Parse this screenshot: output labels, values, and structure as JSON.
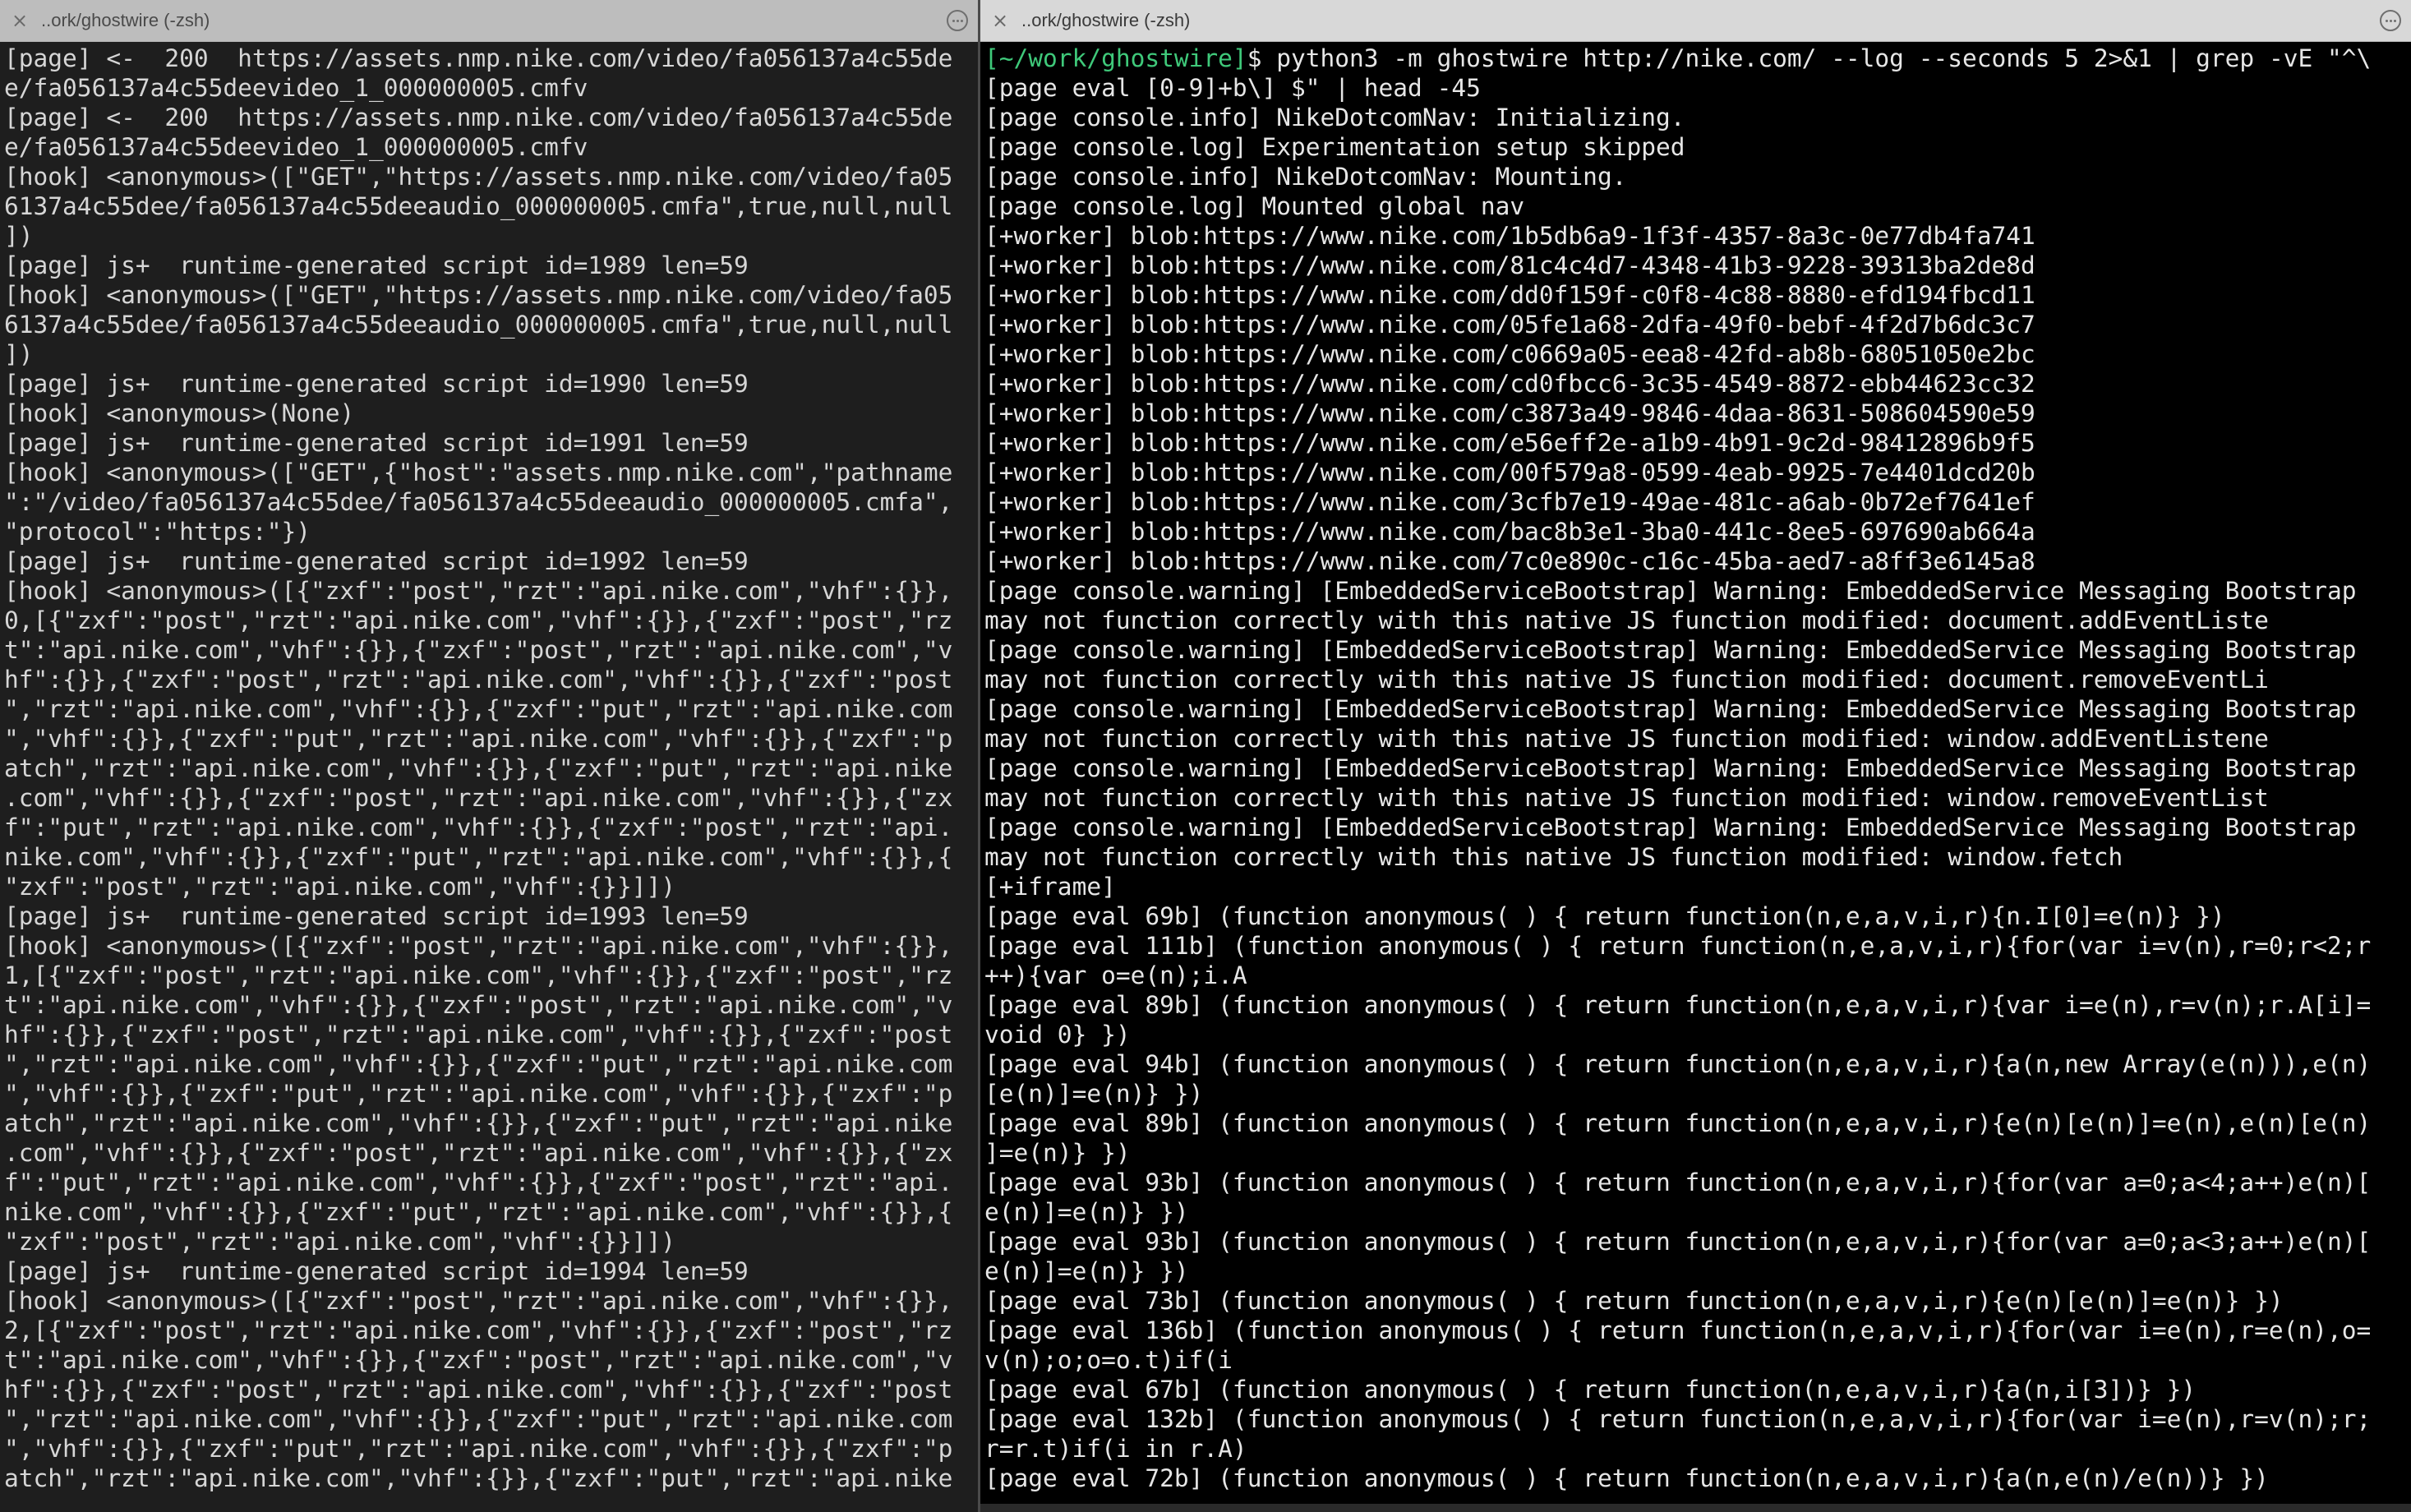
{
  "left_pane": {
    "tab_title": "..ork/ghostwire (-zsh)",
    "lines": [
      "[page] <-  200  https://assets.nmp.nike.com/video/fa056137a4c55de",
      "e/fa056137a4c55deevideo_1_000000005.cmfv",
      "[page] <-  200  https://assets.nmp.nike.com/video/fa056137a4c55de",
      "e/fa056137a4c55deevideo_1_000000005.cmfv",
      "[hook] <anonymous>([\"GET\",\"https://assets.nmp.nike.com/video/fa05",
      "6137a4c55dee/fa056137a4c55deeaudio_000000005.cmfa\",true,null,null",
      "])",
      "[page] js+  runtime-generated script id=1989 len=59",
      "[hook] <anonymous>([\"GET\",\"https://assets.nmp.nike.com/video/fa05",
      "6137a4c55dee/fa056137a4c55deeaudio_000000005.cmfa\",true,null,null",
      "])",
      "[page] js+  runtime-generated script id=1990 len=59",
      "[hook] <anonymous>(None)",
      "[page] js+  runtime-generated script id=1991 len=59",
      "[hook] <anonymous>([\"GET\",{\"host\":\"assets.nmp.nike.com\",\"pathname",
      "\":\"/video/fa056137a4c55dee/fa056137a4c55deeaudio_000000005.cmfa\",",
      "\"protocol\":\"https:\"})",
      "[page] js+  runtime-generated script id=1992 len=59",
      "[hook] <anonymous>([{\"zxf\":\"post\",\"rzt\":\"api.nike.com\",\"vhf\":{}},",
      "0,[{\"zxf\":\"post\",\"rzt\":\"api.nike.com\",\"vhf\":{}},{\"zxf\":\"post\",\"rz",
      "t\":\"api.nike.com\",\"vhf\":{}},{\"zxf\":\"post\",\"rzt\":\"api.nike.com\",\"v",
      "hf\":{}},{\"zxf\":\"post\",\"rzt\":\"api.nike.com\",\"vhf\":{}},{\"zxf\":\"post",
      "\",\"rzt\":\"api.nike.com\",\"vhf\":{}},{\"zxf\":\"put\",\"rzt\":\"api.nike.com",
      "\",\"vhf\":{}},{\"zxf\":\"put\",\"rzt\":\"api.nike.com\",\"vhf\":{}},{\"zxf\":\"p",
      "atch\",\"rzt\":\"api.nike.com\",\"vhf\":{}},{\"zxf\":\"put\",\"rzt\":\"api.nike",
      ".com\",\"vhf\":{}},{\"zxf\":\"post\",\"rzt\":\"api.nike.com\",\"vhf\":{}},{\"zx",
      "f\":\"put\",\"rzt\":\"api.nike.com\",\"vhf\":{}},{\"zxf\":\"post\",\"rzt\":\"api.",
      "nike.com\",\"vhf\":{}},{\"zxf\":\"put\",\"rzt\":\"api.nike.com\",\"vhf\":{}},{",
      "\"zxf\":\"post\",\"rzt\":\"api.nike.com\",\"vhf\":{}}]])",
      "[page] js+  runtime-generated script id=1993 len=59",
      "[hook] <anonymous>([{\"zxf\":\"post\",\"rzt\":\"api.nike.com\",\"vhf\":{}},",
      "1,[{\"zxf\":\"post\",\"rzt\":\"api.nike.com\",\"vhf\":{}},{\"zxf\":\"post\",\"rz",
      "t\":\"api.nike.com\",\"vhf\":{}},{\"zxf\":\"post\",\"rzt\":\"api.nike.com\",\"v",
      "hf\":{}},{\"zxf\":\"post\",\"rzt\":\"api.nike.com\",\"vhf\":{}},{\"zxf\":\"post",
      "\",\"rzt\":\"api.nike.com\",\"vhf\":{}},{\"zxf\":\"put\",\"rzt\":\"api.nike.com",
      "\",\"vhf\":{}},{\"zxf\":\"put\",\"rzt\":\"api.nike.com\",\"vhf\":{}},{\"zxf\":\"p",
      "atch\",\"rzt\":\"api.nike.com\",\"vhf\":{}},{\"zxf\":\"put\",\"rzt\":\"api.nike",
      ".com\",\"vhf\":{}},{\"zxf\":\"post\",\"rzt\":\"api.nike.com\",\"vhf\":{}},{\"zx",
      "f\":\"put\",\"rzt\":\"api.nike.com\",\"vhf\":{}},{\"zxf\":\"post\",\"rzt\":\"api.",
      "nike.com\",\"vhf\":{}},{\"zxf\":\"put\",\"rzt\":\"api.nike.com\",\"vhf\":{}},{",
      "\"zxf\":\"post\",\"rzt\":\"api.nike.com\",\"vhf\":{}}]])",
      "[page] js+  runtime-generated script id=1994 len=59",
      "[hook] <anonymous>([{\"zxf\":\"post\",\"rzt\":\"api.nike.com\",\"vhf\":{}},",
      "2,[{\"zxf\":\"post\",\"rzt\":\"api.nike.com\",\"vhf\":{}},{\"zxf\":\"post\",\"rz",
      "t\":\"api.nike.com\",\"vhf\":{}},{\"zxf\":\"post\",\"rzt\":\"api.nike.com\",\"v",
      "hf\":{}},{\"zxf\":\"post\",\"rzt\":\"api.nike.com\",\"vhf\":{}},{\"zxf\":\"post",
      "\",\"rzt\":\"api.nike.com\",\"vhf\":{}},{\"zxf\":\"put\",\"rzt\":\"api.nike.com",
      "\",\"vhf\":{}},{\"zxf\":\"put\",\"rzt\":\"api.nike.com\",\"vhf\":{}},{\"zxf\":\"p",
      "atch\",\"rzt\":\"api.nike.com\",\"vhf\":{}},{\"zxf\":\"put\",\"rzt\":\"api.nike"
    ]
  },
  "right_pane": {
    "tab_title": "..ork/ghostwire (-zsh)",
    "prompt": {
      "path": "[~/work/ghostwire]",
      "sign": "$",
      "command": " python3 -m ghostwire http://nike.com/ --log --seconds 5 2>&1 | grep -vE \"^\\"
    },
    "lines": [
      "[page eval [0-9]+b\\] $\" | head -45",
      "[page console.info] NikeDotcomNav: Initializing.",
      "[page console.log] Experimentation setup skipped",
      "[page console.info] NikeDotcomNav: Mounting.",
      "[page console.log] Mounted global nav",
      "[+worker] blob:https://www.nike.com/1b5db6a9-1f3f-4357-8a3c-0e77db4fa741",
      "[+worker] blob:https://www.nike.com/81c4c4d7-4348-41b3-9228-39313ba2de8d",
      "[+worker] blob:https://www.nike.com/dd0f159f-c0f8-4c88-8880-efd194fbcd11",
      "[+worker] blob:https://www.nike.com/05fe1a68-2dfa-49f0-bebf-4f2d7b6dc3c7",
      "[+worker] blob:https://www.nike.com/c0669a05-eea8-42fd-ab8b-68051050e2bc",
      "[+worker] blob:https://www.nike.com/cd0fbcc6-3c35-4549-8872-ebb44623cc32",
      "[+worker] blob:https://www.nike.com/c3873a49-9846-4daa-8631-508604590e59",
      "[+worker] blob:https://www.nike.com/e56eff2e-a1b9-4b91-9c2d-98412896b9f5",
      "[+worker] blob:https://www.nike.com/00f579a8-0599-4eab-9925-7e4401dcd20b",
      "[+worker] blob:https://www.nike.com/3cfb7e19-49ae-481c-a6ab-0b72ef7641ef",
      "[+worker] blob:https://www.nike.com/bac8b3e1-3ba0-441c-8ee5-697690ab664a",
      "[+worker] blob:https://www.nike.com/7c0e890c-c16c-45ba-aed7-a8ff3e6145a8",
      "[page console.warning] [EmbeddedServiceBootstrap] Warning: EmbeddedService Messaging Bootstrap",
      "may not function correctly with this native JS function modified: document.addEventListe",
      "[page console.warning] [EmbeddedServiceBootstrap] Warning: EmbeddedService Messaging Bootstrap",
      "may not function correctly with this native JS function modified: document.removeEventLi",
      "[page console.warning] [EmbeddedServiceBootstrap] Warning: EmbeddedService Messaging Bootstrap",
      "may not function correctly with this native JS function modified: window.addEventListene",
      "[page console.warning] [EmbeddedServiceBootstrap] Warning: EmbeddedService Messaging Bootstrap",
      "may not function correctly with this native JS function modified: window.removeEventList",
      "[page console.warning] [EmbeddedServiceBootstrap] Warning: EmbeddedService Messaging Bootstrap",
      "may not function correctly with this native JS function modified: window.fetch",
      "[+iframe]",
      "[page eval 69b] (function anonymous( ) { return function(n,e,a,v,i,r){n.I[0]=e(n)} })",
      "[page eval 111b] (function anonymous( ) { return function(n,e,a,v,i,r){for(var i=v(n),r=0;r<2;r",
      "++){var o=e(n);i.A",
      "[page eval 89b] (function anonymous( ) { return function(n,e,a,v,i,r){var i=e(n),r=v(n);r.A[i]=",
      "void 0} })",
      "[page eval 94b] (function anonymous( ) { return function(n,e,a,v,i,r){a(n,new Array(e(n))),e(n)",
      "[e(n)]=e(n)} })",
      "[page eval 89b] (function anonymous( ) { return function(n,e,a,v,i,r){e(n)[e(n)]=e(n),e(n)[e(n)",
      "]=e(n)} })",
      "[page eval 93b] (function anonymous( ) { return function(n,e,a,v,i,r){for(var a=0;a<4;a++)e(n)[",
      "e(n)]=e(n)} })",
      "[page eval 93b] (function anonymous( ) { return function(n,e,a,v,i,r){for(var a=0;a<3;a++)e(n)[",
      "e(n)]=e(n)} })",
      "[page eval 73b] (function anonymous( ) { return function(n,e,a,v,i,r){e(n)[e(n)]=e(n)} })",
      "[page eval 136b] (function anonymous( ) { return function(n,e,a,v,i,r){for(var i=e(n),r=e(n),o=",
      "v(n);o;o=o.t)if(i",
      "[page eval 67b] (function anonymous( ) { return function(n,e,a,v,i,r){a(n,i[3])} })",
      "[page eval 132b] (function anonymous( ) { return function(n,e,a,v,i,r){for(var i=e(n),r=v(n);r;",
      "r=r.t)if(i in r.A)",
      "[page eval 72b] (function anonymous( ) { return function(n,e,a,v,i,r){a(n,e(n)/e(n))} })"
    ]
  },
  "colors": {
    "left_background": "#1e1e1e",
    "right_background": "#000000",
    "prompt_path": "#3fc97a",
    "text": "#e6e6e6"
  }
}
